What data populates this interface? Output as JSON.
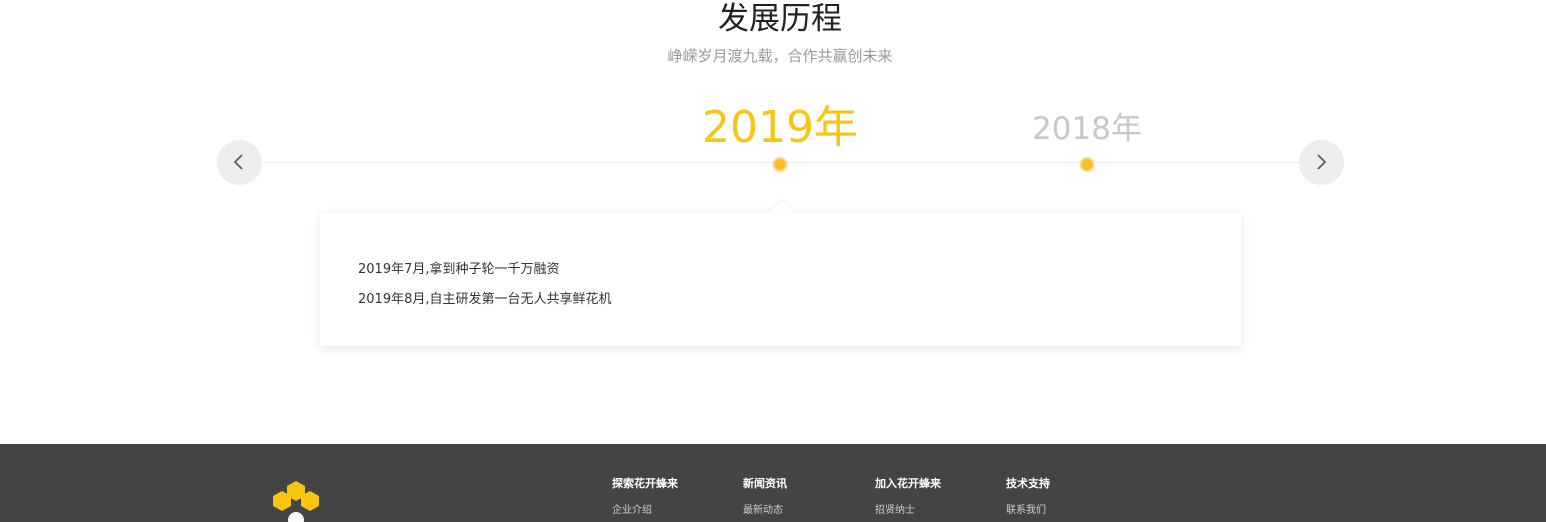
{
  "section": {
    "title": "发展历程",
    "subtitle": "峥嵘岁月渡九载，合作共赢创未来"
  },
  "timeline": {
    "years": [
      {
        "label": "2019年",
        "active": true
      },
      {
        "label": "2018年",
        "active": false
      }
    ],
    "events": [
      "2019年7月,拿到种子轮一千万融资",
      "2019年8月,自主研发第一台无人共享鲜花机"
    ]
  },
  "colors": {
    "accent": "#f8c513",
    "dot": "#fbbd2a",
    "inactive_year": "#c8c8c8",
    "footer_bg": "#444444"
  },
  "icons": {
    "prev": "chevron-left-icon",
    "next": "chevron-right-icon",
    "logo": "honeycomb-logo-icon"
  },
  "footer": {
    "columns": [
      {
        "title": "探索花开蜂来",
        "link": "企业介绍"
      },
      {
        "title": "新闻资讯",
        "link": "最新动态"
      },
      {
        "title": "加入花开蜂来",
        "link": "招贤纳士"
      },
      {
        "title": "技术支持",
        "link": "联系我们"
      }
    ]
  }
}
